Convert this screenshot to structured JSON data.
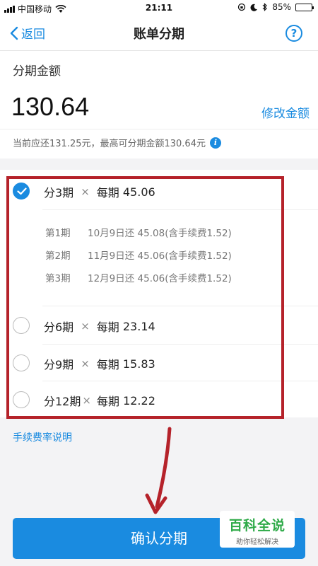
{
  "status_bar": {
    "carrier": "中国移动",
    "time": "21:11",
    "battery": "85%",
    "battery_level": 0.85
  },
  "nav": {
    "back_label": "返回",
    "title": "账单分期"
  },
  "amount": {
    "label": "分期金额",
    "value": "130.64",
    "modify_label": "修改金额",
    "hint": "当前应还131.25元，最高可分期金额130.64元"
  },
  "plans": [
    {
      "name": "分3期",
      "times": "×",
      "per_label": "每期",
      "per_amount": "45.06",
      "selected": true
    },
    {
      "name": "分6期",
      "times": "×",
      "per_label": "每期",
      "per_amount": "23.14",
      "selected": false
    },
    {
      "name": "分9期",
      "times": "×",
      "per_label": "每期",
      "per_amount": "15.83",
      "selected": false
    },
    {
      "name": "分12期",
      "times": "×",
      "per_label": "每期",
      "per_amount": "12.22",
      "selected": false
    }
  ],
  "schedule": [
    {
      "period": "第1期",
      "detail": "10月9日还 45.08(含手续费1.52)"
    },
    {
      "period": "第2期",
      "detail": "11月9日还 45.06(含手续费1.52)"
    },
    {
      "period": "第3期",
      "detail": "12月9日还 45.06(含手续费1.52)"
    }
  ],
  "fee_link": "手续费率说明",
  "confirm_label": "确认分期",
  "watermark": {
    "title": "百科全说",
    "subtitle": "助你轻松解决"
  },
  "colors": {
    "accent": "#1a8be0",
    "highlight_border": "#b5222a",
    "watermark_green": "#2eaa48"
  }
}
